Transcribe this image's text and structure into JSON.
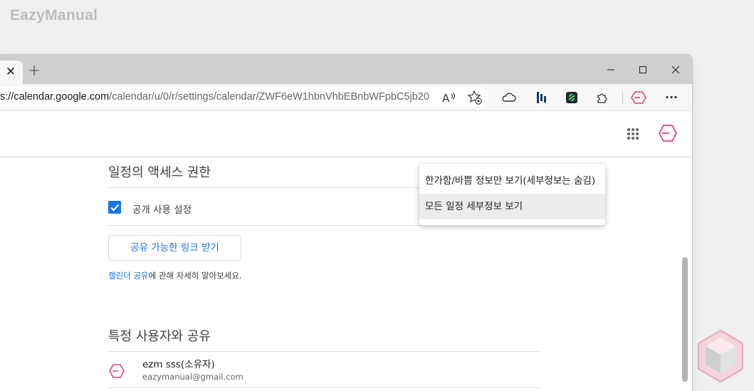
{
  "watermark": {
    "text": "EazyManual"
  },
  "browser": {
    "tab_close": "✕",
    "new_tab": "+",
    "address": {
      "host": "s://calendar.google.com",
      "path": "/calendar/u/0/r/settings/calendar/ZWF6eW1hbnVhbEBnbWFpbC5jb20"
    },
    "toolbar_icons": [
      "read-aloud-icon",
      "add-favorite-icon",
      "cloud-icon",
      "extension-bar-icon",
      "extension-link-icon",
      "extensions-puzzle-icon",
      "profile-icon",
      "more-icon"
    ],
    "more_label": "···"
  },
  "calendar": {
    "access_section": {
      "title": "일정의 액세스 권한",
      "public_checkbox_label": "공개 사용 설정",
      "public_checked": true,
      "share_link_button": "공유 가능한 링크 받기",
      "help_link": "캘린더 공유",
      "help_rest": "에 관해 자세히 알아보세요."
    },
    "share_section": {
      "title": "특정 사용자와 공유",
      "user": {
        "name": "ezm sss(소유자)",
        "email": "eazymanual@gmail.com"
      }
    },
    "dropdown": {
      "options": [
        "한가함/바쁨 정보만 보기(세부정보는 숨김)",
        "모든 일정 세부정보 보기"
      ],
      "selected_index": 1
    }
  },
  "colors": {
    "accent": "#1a73e8",
    "profile_pink": "#e0446e"
  }
}
